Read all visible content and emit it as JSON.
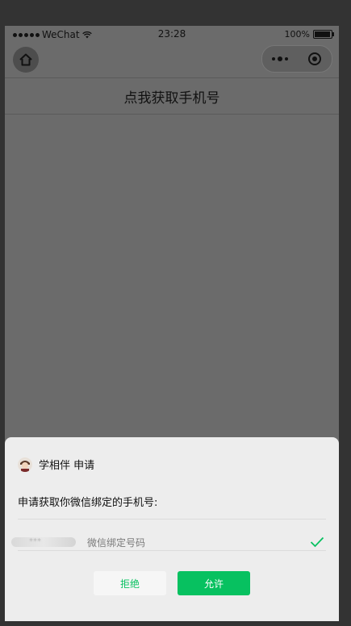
{
  "status_bar": {
    "carrier": "WeChat",
    "time": "23:28",
    "battery_label": "100%"
  },
  "nav": {
    "home_icon": "home-icon",
    "title": "点我获取手机号"
  },
  "dialog": {
    "app_name": "学相伴 申请",
    "request_text": "申请获取你微信绑定的手机号:",
    "phone_masked": "***",
    "phone_desc": "微信绑定号码",
    "deny_label": "拒绝",
    "allow_label": "允许",
    "accent_color": "#07c160"
  }
}
